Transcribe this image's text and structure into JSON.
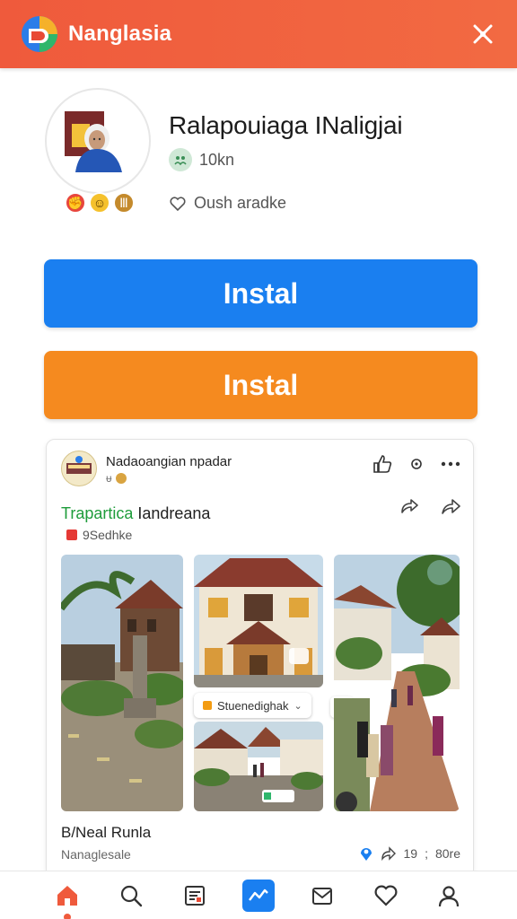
{
  "header": {
    "title": "Nanglasia",
    "logo_icon": "app-logo-icon",
    "close_icon": "close-icon"
  },
  "profile": {
    "name": "Ralapouiaga INaligjai",
    "followers": "10kn",
    "location": "Oush aradke",
    "reactions": [
      "angry-icon",
      "laugh-icon",
      "badge-icon"
    ]
  },
  "buttons": {
    "primary_label": "Instal",
    "secondary_label": "Instal"
  },
  "post": {
    "author": "Nadaoangian npadar",
    "meta": "ᵾ",
    "title_highlight": "Trapartica",
    "title_rest": " Iandreana",
    "tag": "9Sedhke",
    "chip_label": "Stuenedighak",
    "chip_extra": "?",
    "caption": "B/Neal Runla",
    "subcaption": "Nanaglesale",
    "stats_a": "19",
    "stats_sep": ";",
    "stats_b": "80re"
  },
  "nav": {
    "items": [
      "home-icon",
      "search-icon",
      "feed-icon",
      "activity-icon",
      "inbox-icon",
      "heart-icon",
      "profile-icon"
    ],
    "active_index": 3
  },
  "colors": {
    "header": "#ef5a3c",
    "primary": "#1a7ff0",
    "secondary": "#f58a1f",
    "highlight": "#1e9c3b"
  }
}
